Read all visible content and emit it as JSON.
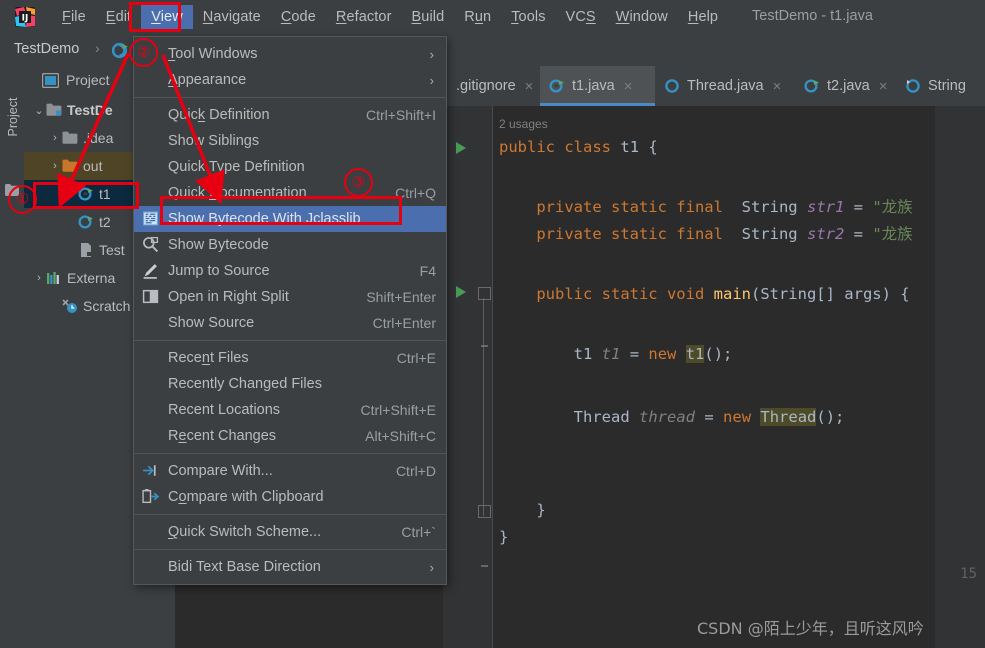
{
  "window": {
    "title": "TestDemo - t1.java",
    "app_icon": "intellij-idea-logo"
  },
  "menubar": {
    "items": [
      {
        "label": "File",
        "mnemonic": "F",
        "active": false
      },
      {
        "label": "Edit",
        "mnemonic": "E",
        "active": false
      },
      {
        "label": "View",
        "mnemonic": "V",
        "active": true
      },
      {
        "label": "Navigate",
        "mnemonic": "N",
        "active": false
      },
      {
        "label": "Code",
        "mnemonic": "C",
        "active": false
      },
      {
        "label": "Refactor",
        "mnemonic": "R",
        "active": false
      },
      {
        "label": "Build",
        "mnemonic": "B",
        "active": false
      },
      {
        "label": "Run",
        "mnemonic": "u",
        "active": false
      },
      {
        "label": "Tools",
        "mnemonic": "T",
        "active": false
      },
      {
        "label": "VCS",
        "mnemonic": "S",
        "active": false
      },
      {
        "label": "Window",
        "mnemonic": "W",
        "active": false
      },
      {
        "label": "Help",
        "mnemonic": "H",
        "active": false
      }
    ]
  },
  "navbar": {
    "project_name": "TestDemo",
    "separator": "›",
    "file_icon": "java-class-runnable-icon"
  },
  "toolstrip": {
    "project_label": "Project",
    "folder_icon": "folder-icon"
  },
  "project_panel": {
    "header_label": "Project",
    "header_icon": "project-view-icon",
    "tree": [
      {
        "label": "TestDe",
        "icon": "module-folder-icon",
        "indent": 0,
        "twisty": "⌄",
        "bold": true,
        "selected": "none"
      },
      {
        "label": ".idea",
        "icon": "folder-icon",
        "indent": 1,
        "twisty": "›",
        "bold": false,
        "selected": "none"
      },
      {
        "label": "out",
        "icon": "folder-orange-icon",
        "indent": 1,
        "twisty": "›",
        "bold": false,
        "selected": "dir"
      },
      {
        "label": "t1",
        "icon": "java-class-runnable-icon",
        "indent": 2,
        "twisty": "",
        "bold": false,
        "selected": "file"
      },
      {
        "label": "t2",
        "icon": "java-class-runnable-icon",
        "indent": 2,
        "twisty": "",
        "bold": false,
        "selected": "none"
      },
      {
        "label": "Test",
        "icon": "java-file-icon",
        "indent": 2,
        "twisty": "",
        "bold": false,
        "selected": "none"
      },
      {
        "label": "Externa",
        "icon": "external-libraries-icon",
        "indent": 0,
        "twisty": "›",
        "bold": false,
        "selected": "none"
      },
      {
        "label": "Scratch",
        "icon": "scratches-icon",
        "indent": 1,
        "twisty": "",
        "bold": false,
        "selected": "none"
      }
    ]
  },
  "editor_tabs": [
    {
      "label": ".gitignore",
      "icon": "none",
      "active": false,
      "close_icon": "close-icon"
    },
    {
      "label": "t1.java",
      "icon": "java-class-runnable-icon",
      "active": true,
      "close_icon": "close-icon"
    },
    {
      "label": "Thread.java",
      "icon": "java-class-icon",
      "active": false,
      "close_icon": "close-icon"
    },
    {
      "label": "t2.java",
      "icon": "java-class-runnable-icon",
      "active": false,
      "close_icon": "close-icon"
    },
    {
      "label": "String",
      "icon": "java-class-readonly-icon",
      "active": false,
      "close_icon": "close-icon"
    }
  ],
  "editor": {
    "usages_hint": "2 usages",
    "gutter_line_number": "15",
    "code": {
      "l1_kw_public": "public",
      "l1_kw_class": "class",
      "l1_name": "t1",
      "l1_brace": "{",
      "l2_mods": "private static final",
      "l2_type": "String",
      "l2_field": "str1",
      "l2_eq": "=",
      "l2_value": "\"龙族",
      "l3_mods": "private static final",
      "l3_type": "String",
      "l3_field": "str2",
      "l3_eq": "=",
      "l3_value": "\"龙族",
      "l4_sig": "public static void",
      "l4_main": "main",
      "l4_params": "(String[] args) {",
      "l5_type": "t1",
      "l5_var": "t1",
      "l5_eq": "=",
      "l5_new": "new",
      "l5_ctor": "t1",
      "l5_tail": "();",
      "l6_type": "Thread",
      "l6_var": "thread",
      "l6_eq": "=",
      "l6_new": "new",
      "l6_ctor": "Thread",
      "l6_tail": "();",
      "l7_close": "}",
      "l8_close": "}"
    }
  },
  "view_menu": {
    "items": [
      {
        "label": "Tool Windows",
        "mnemonic": "T",
        "accel": "",
        "icon": "none",
        "submenu": true,
        "highlighted": false,
        "separator_after": false
      },
      {
        "label": "Appearance",
        "mnemonic": "A",
        "accel": "",
        "icon": "none",
        "submenu": true,
        "highlighted": false,
        "separator_after": true
      },
      {
        "label": "Quick Definition",
        "mnemonic": "k",
        "accel": "Ctrl+Shift+I",
        "icon": "none",
        "submenu": false,
        "highlighted": false,
        "separator_after": false
      },
      {
        "label": "Show Siblings",
        "mnemonic": "",
        "accel": "",
        "icon": "none",
        "submenu": false,
        "highlighted": false,
        "separator_after": false
      },
      {
        "label": "Quick Type Definition",
        "mnemonic": "",
        "accel": "",
        "icon": "none",
        "submenu": false,
        "highlighted": false,
        "separator_after": false
      },
      {
        "label": "Quick Documentation",
        "mnemonic": "D",
        "accel": "Ctrl+Q",
        "icon": "none",
        "submenu": false,
        "highlighted": false,
        "separator_after": false
      },
      {
        "label": "Show Bytecode With Jclasslib",
        "mnemonic": "",
        "accel": "",
        "icon": "jclasslib-icon",
        "submenu": false,
        "highlighted": true,
        "separator_after": false
      },
      {
        "label": "Show Bytecode",
        "mnemonic": "",
        "accel": "",
        "icon": "bytecode-icon",
        "submenu": false,
        "highlighted": false,
        "separator_after": false
      },
      {
        "label": "Jump to Source",
        "mnemonic": "",
        "accel": "F4",
        "icon": "edit-source-icon",
        "submenu": false,
        "highlighted": false,
        "separator_after": false
      },
      {
        "label": "Open in Right Split",
        "mnemonic": "",
        "accel": "Shift+Enter",
        "icon": "split-icon",
        "submenu": false,
        "highlighted": false,
        "separator_after": false
      },
      {
        "label": "Show Source",
        "mnemonic": "",
        "accel": "Ctrl+Enter",
        "icon": "none",
        "submenu": false,
        "highlighted": false,
        "separator_after": true
      },
      {
        "label": "Recent Files",
        "mnemonic": "n",
        "accel": "Ctrl+E",
        "icon": "none",
        "submenu": false,
        "highlighted": false,
        "separator_after": false
      },
      {
        "label": "Recently Changed Files",
        "mnemonic": "",
        "accel": "",
        "icon": "none",
        "submenu": false,
        "highlighted": false,
        "separator_after": false
      },
      {
        "label": "Recent Locations",
        "mnemonic": "",
        "accel": "Ctrl+Shift+E",
        "icon": "none",
        "submenu": false,
        "highlighted": false,
        "separator_after": false
      },
      {
        "label": "Recent Changes",
        "mnemonic": "e",
        "accel": "Alt+Shift+C",
        "icon": "none",
        "submenu": false,
        "highlighted": false,
        "separator_after": true
      },
      {
        "label": "Compare With...",
        "mnemonic": "",
        "accel": "Ctrl+D",
        "icon": "compare-icon",
        "submenu": false,
        "highlighted": false,
        "separator_after": false
      },
      {
        "label": "Compare with Clipboard",
        "mnemonic": "o",
        "accel": "",
        "icon": "compare-clipboard-icon",
        "submenu": false,
        "highlighted": false,
        "separator_after": true
      },
      {
        "label": "Quick Switch Scheme...",
        "mnemonic": "Q",
        "accel": "Ctrl+`",
        "icon": "none",
        "submenu": false,
        "highlighted": false,
        "separator_after": true
      },
      {
        "label": "Bidi Text Base Direction",
        "mnemonic": "",
        "accel": "",
        "icon": "none",
        "submenu": true,
        "highlighted": false,
        "separator_after": false
      }
    ]
  },
  "annotations": {
    "marker_1": "①",
    "marker_2": "②",
    "marker_3": "③",
    "accent_color": "#e60012"
  },
  "watermark": {
    "text": "CSDN @陌上少年，且听这风吟"
  }
}
